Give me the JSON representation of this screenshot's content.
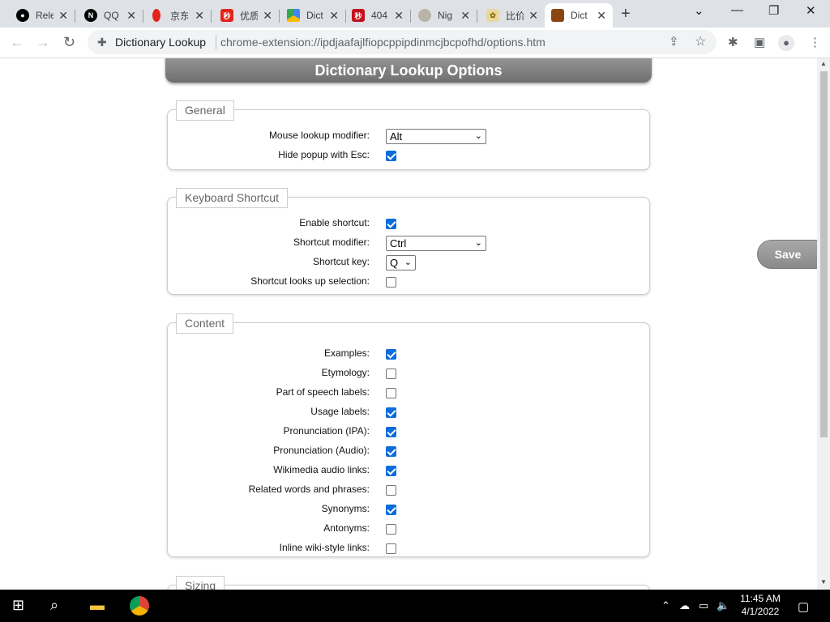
{
  "tabs": [
    {
      "title": "Rele",
      "favicon": "github-icon",
      "color": "#000000"
    },
    {
      "title": "QQ",
      "favicon": "notion-icon",
      "color": "#000000"
    },
    {
      "title": "京东",
      "favicon": "jd-icon",
      "color": "#e1251b"
    },
    {
      "title": "优质",
      "favicon": "miaosha-icon",
      "color": "#e2231a"
    },
    {
      "title": "Dict",
      "favicon": "drive-icon",
      "color": "#4285f4"
    },
    {
      "title": "404",
      "favicon": "miaosha-icon",
      "color": "#c1121f"
    },
    {
      "title": "Nig",
      "favicon": "globe-icon",
      "color": "#9aa0a6"
    },
    {
      "title": "比价",
      "favicon": "coupon-icon",
      "color": "#d4a017"
    },
    {
      "title": "Dict",
      "favicon": "book-icon",
      "color": "#8b4513",
      "active": true
    }
  ],
  "address": {
    "site": "Dictionary Lookup",
    "url": "chrome-extension://ipdjaafajlfiopcppipdinmcjbcpofhd/options.htm"
  },
  "page": {
    "title": "Dictionary Lookup Options",
    "save_label": "Save",
    "sections": {
      "general": {
        "legend": "General",
        "mouse_modifier_label": "Mouse lookup modifier:",
        "mouse_modifier_value": "Alt",
        "hide_popup_label": "Hide popup with Esc:",
        "hide_popup_checked": true
      },
      "keyboard": {
        "legend": "Keyboard Shortcut",
        "enable_label": "Enable shortcut:",
        "enable_checked": true,
        "modifier_label": "Shortcut modifier:",
        "modifier_value": "Ctrl",
        "key_label": "Shortcut key:",
        "key_value": "Q",
        "selection_label": "Shortcut looks up selection:",
        "selection_checked": false
      },
      "content": {
        "legend": "Content",
        "items": [
          {
            "label": "Examples:",
            "checked": true
          },
          {
            "label": "Etymology:",
            "checked": false
          },
          {
            "label": "Part of speech labels:",
            "checked": false
          },
          {
            "label": "Usage labels:",
            "checked": true
          },
          {
            "label": "Pronunciation (IPA):",
            "checked": true
          },
          {
            "label": "Pronunciation (Audio):",
            "checked": true
          },
          {
            "label": "Wikimedia audio links:",
            "checked": true
          },
          {
            "label": "Related words and phrases:",
            "checked": false
          },
          {
            "label": "Synonyms:",
            "checked": true
          },
          {
            "label": "Antonyms:",
            "checked": false
          },
          {
            "label": "Inline wiki-style links:",
            "checked": false
          }
        ]
      },
      "sizing": {
        "legend": "Sizing"
      }
    }
  },
  "taskbar": {
    "time": "11:45 AM",
    "date": "4/1/2022"
  }
}
